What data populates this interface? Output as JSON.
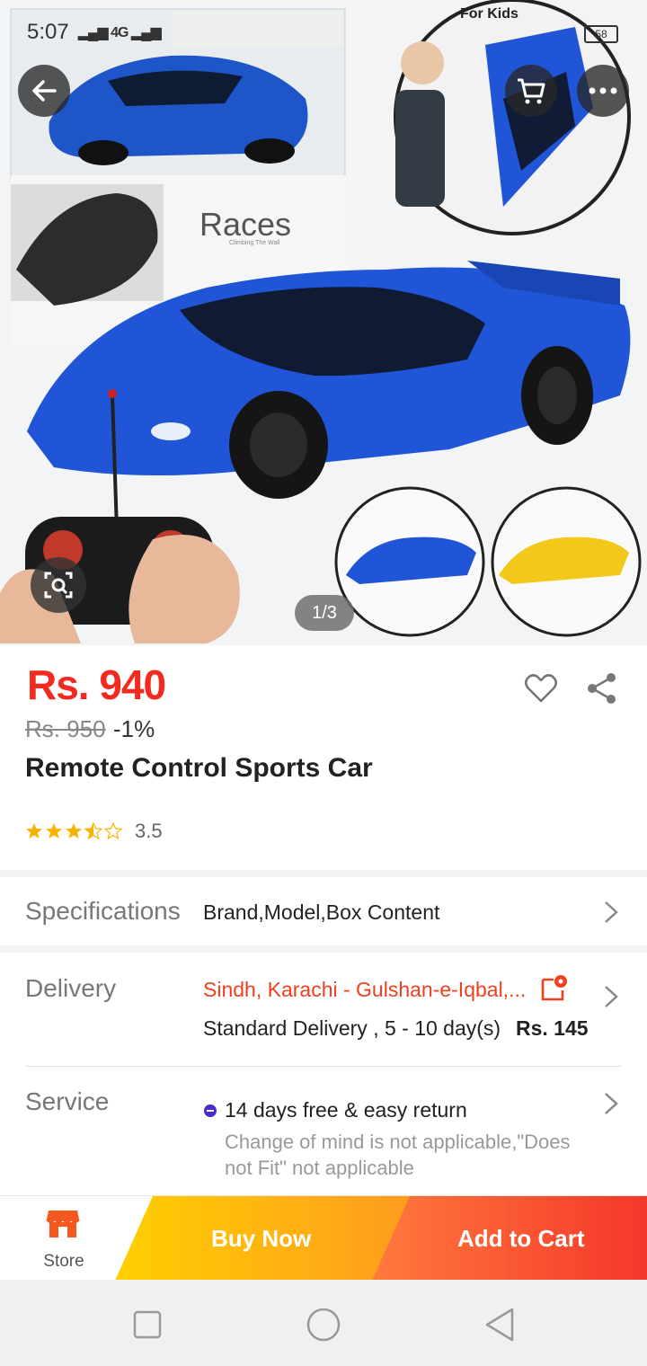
{
  "status_bar": {
    "time": "5:07",
    "network": "4G",
    "battery": "58"
  },
  "gallery": {
    "counter": "1/3",
    "brand_text": "Races",
    "badge_text": "For Kids"
  },
  "product": {
    "price": "Rs. 940",
    "original_price": "Rs. 950",
    "discount": "-1%",
    "title": "Remote Control Sports Car",
    "rating": 3.5,
    "rating_text": "3.5"
  },
  "specifications": {
    "label": "Specifications",
    "value": "Brand,Model,Box Content"
  },
  "delivery": {
    "label": "Delivery",
    "location": "Sindh, Karachi - Gulshan-e-Iqbal,...",
    "method": "Standard Delivery , 5 - 10 day(s)",
    "fee": "Rs. 145"
  },
  "service": {
    "label": "Service",
    "title": "14 days free & easy return",
    "description": "Change of mind is not applicable,\"Does not Fit\" not applicable"
  },
  "bottom_bar": {
    "store_label": "Store",
    "buy_now_label": "Buy Now",
    "add_to_cart_label": "Add to Cart"
  },
  "colors": {
    "price": "#f22a1f",
    "accent": "#f5372a",
    "buy_now": "#ffb000",
    "star": "#f5b400"
  },
  "icons": [
    "back-arrow-icon",
    "cart-icon",
    "more-icon",
    "camera-search-icon",
    "heart-icon",
    "share-icon",
    "chevron-right-icon",
    "store-icon",
    "location-edit-icon",
    "return-icon"
  ]
}
